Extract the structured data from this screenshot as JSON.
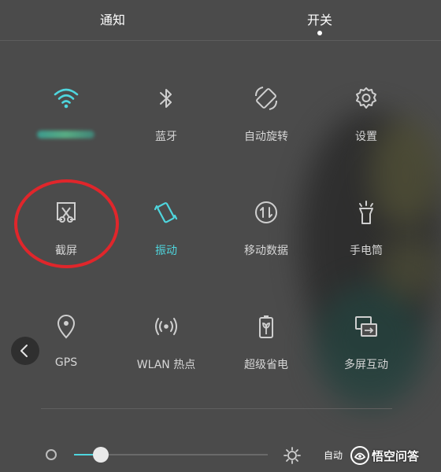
{
  "header": {
    "tabs": [
      {
        "label": "通知"
      },
      {
        "label": "开关",
        "selected": true
      }
    ]
  },
  "tiles": [
    {
      "label": "",
      "icon": "wifi-icon",
      "active": true,
      "label_obscured": true
    },
    {
      "label": "蓝牙",
      "icon": "bluetooth-icon",
      "active": false
    },
    {
      "label": "自动旋转",
      "icon": "auto-rotate-icon",
      "active": false
    },
    {
      "label": "设置",
      "icon": "settings-gear-icon",
      "active": false
    },
    {
      "label": "截屏",
      "icon": "screenshot-icon",
      "active": false
    },
    {
      "label": "振动",
      "icon": "vibrate-icon",
      "active": true
    },
    {
      "label": "移动数据",
      "icon": "mobile-data-icon",
      "active": false
    },
    {
      "label": "手电筒",
      "icon": "flashlight-icon",
      "active": false
    },
    {
      "label": "GPS",
      "icon": "location-pin-icon",
      "active": false
    },
    {
      "label": "WLAN 热点",
      "icon": "hotspot-icon",
      "active": false
    },
    {
      "label": "超级省电",
      "icon": "battery-saver-icon",
      "active": false
    },
    {
      "label": "多屏互动",
      "icon": "multi-screen-icon",
      "active": false
    }
  ],
  "brightness": {
    "level": 0.14,
    "auto_label": "自动"
  },
  "watermark": {
    "text": "悟空问答"
  },
  "colors": {
    "accent": "#4fd6de",
    "annotation": "#e0262b",
    "text": "#d6d6d6",
    "background": "#4b4b4b"
  }
}
